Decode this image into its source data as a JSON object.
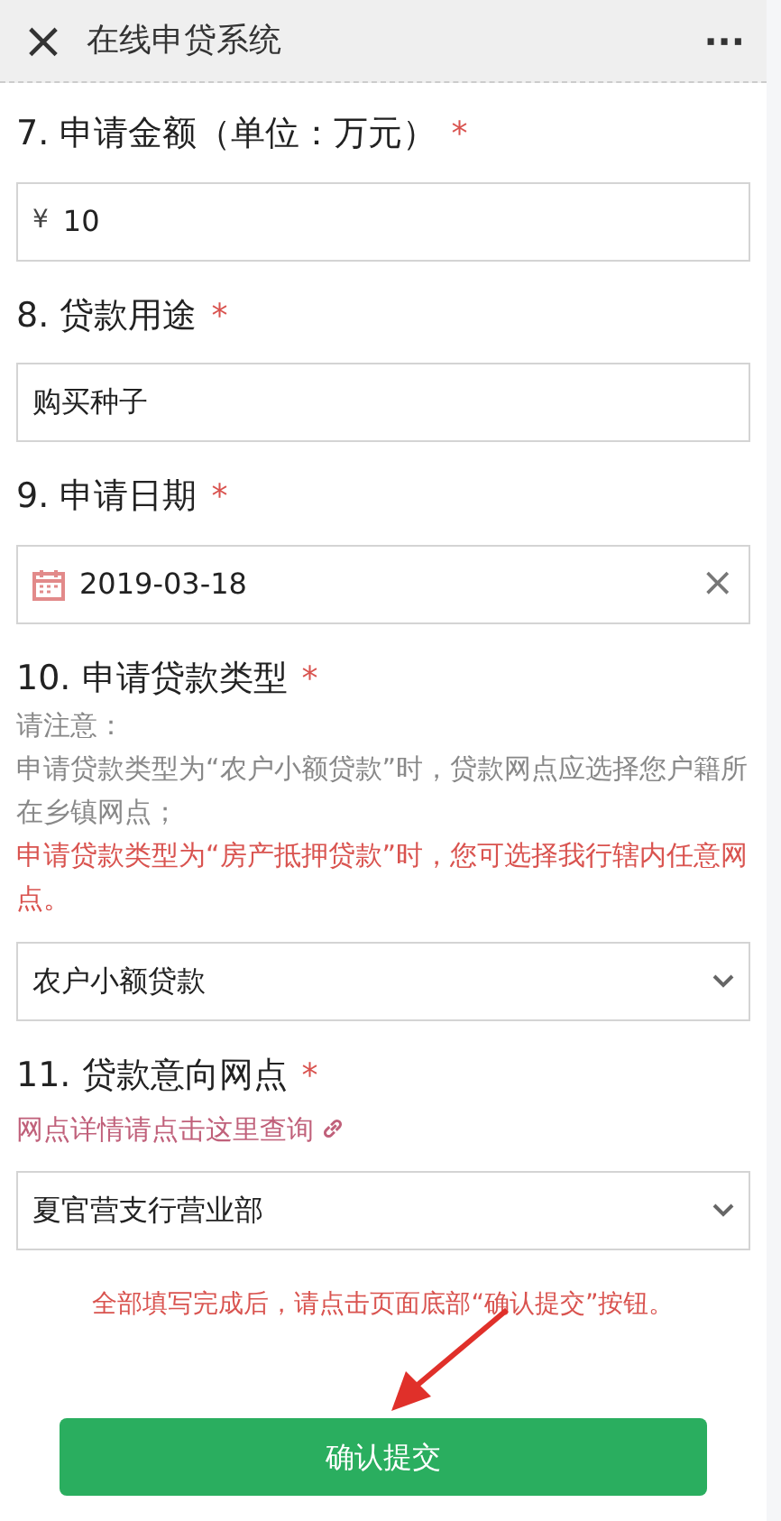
{
  "header": {
    "close": "×",
    "title": "在线申贷系统",
    "more": "···"
  },
  "questions": [
    {
      "kind": "amount",
      "number": "7.",
      "label": "申请金额（单位：万元）",
      "required": "*",
      "prefix": "¥",
      "value": "10"
    },
    {
      "kind": "text",
      "number": "8.",
      "label": "贷款用途",
      "required": "*",
      "value": "购买种子"
    },
    {
      "kind": "date",
      "number": "9.",
      "label": "申请日期",
      "required": "*",
      "value": "2019-03-18",
      "clear": "×"
    },
    {
      "kind": "select",
      "number": "10.",
      "label": "申请贷款类型",
      "required": "*",
      "notes": [
        {
          "kind": "plain",
          "text": "请注意："
        },
        {
          "kind": "plain",
          "text": "申请贷款类型为“农户小额贷款”时，贷款网点应选择您户籍所在乡镇网点；"
        },
        {
          "kind": "warning",
          "text": "申请贷款类型为“房产抵押贷款”时，您可选择我行辖内任意网点。"
        }
      ],
      "value": "农户小额贷款"
    },
    {
      "kind": "select",
      "number": "11.",
      "label": "贷款意向网点",
      "required": "*",
      "link": "网点详情请点击这里查询",
      "value": "夏官营支行营业部"
    }
  ],
  "hint": "全部填写完成后，请点击页面底部“确认提交”按钮。",
  "submit": "确认提交"
}
